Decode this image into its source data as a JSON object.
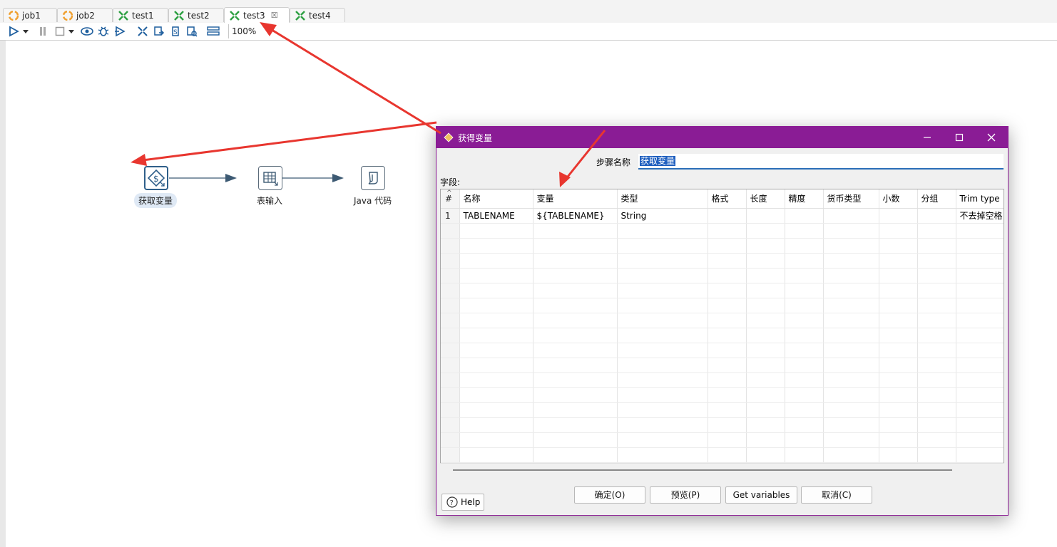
{
  "tabs": [
    {
      "label": "job1",
      "icon": "job-icon"
    },
    {
      "label": "job2",
      "icon": "job-icon"
    },
    {
      "label": "test1",
      "icon": "transformation-icon"
    },
    {
      "label": "test2",
      "icon": "transformation-icon"
    },
    {
      "label": "test3",
      "icon": "transformation-icon",
      "active": true
    },
    {
      "label": "test4",
      "icon": "transformation-icon"
    }
  ],
  "toolbar": {
    "zoom": "100%",
    "buttons": [
      "run-icon",
      "run-dropdown-icon",
      "pause-icon",
      "stop-icon",
      "stop-dropdown-icon",
      "preview-icon",
      "debug-icon",
      "replay-icon",
      "verify-icon",
      "impact-icon",
      "sql-icon",
      "explore-db-icon",
      "show-results-icon"
    ]
  },
  "canvas": {
    "steps": [
      {
        "label": "获取变量",
        "icon": "get-variables-icon",
        "selected": true
      },
      {
        "label": "表输入",
        "icon": "table-input-icon"
      },
      {
        "label": "Java 代码",
        "icon": "java-code-icon"
      }
    ]
  },
  "dialog": {
    "title": "获得变量",
    "step_name_label": "步骤名称",
    "step_name_value": "获取变量",
    "fields_label": "字段:",
    "columns": [
      "#",
      "名称",
      "变量",
      "类型",
      "格式",
      "长度",
      "精度",
      "货币类型",
      "小数",
      "分组",
      "Trim type"
    ],
    "rows": [
      [
        "1",
        "TABLENAME",
        "${TABLENAME}",
        "String",
        "",
        "",
        "",
        "",
        "",
        "",
        "不去掉空格"
      ]
    ],
    "buttons": {
      "ok": "确定(O)",
      "preview": "预览(P)",
      "get_variables": "Get variables",
      "cancel": "取消(C)",
      "help": "Help"
    },
    "window_controls": [
      "minimize-icon",
      "maximize-icon",
      "close-icon"
    ]
  },
  "colors": {
    "dialog_title_bar": "#8a1c95",
    "annotation_arrow": "#e8362f",
    "selection": "#1f5fbf"
  }
}
